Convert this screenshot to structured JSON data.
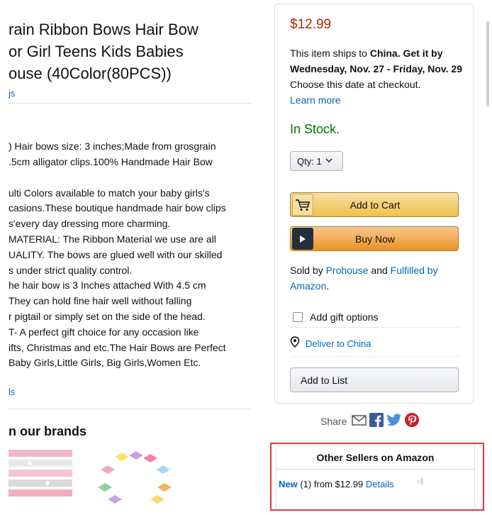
{
  "product": {
    "title_lines": [
      "rain Ribbon Bows Hair Bow",
      "or Girl Teens Kids Babies",
      "ouse (40Color(80PCS))"
    ],
    "cut_link": "js",
    "bullets": [
      ") Hair bows size: 3 inches;Made from grosgrain",
      ".5cm alligator clips.100% Handmade Hair Bow",
      "",
      "ulti Colors available to match your baby girls's",
      "casions.These boutique handmade hair bow clips",
      "s'every day dressing more charming.",
      "MATERIAL: The Ribbon Material we use are all",
      "UALITY. The bows are glued well with our skilled",
      "s under strict quality control.",
      "he hair bow is 3 Inches attached With 4.5 cm",
      " They can hold fine hair well without falling",
      "r pigtail or simply set on the side of the head.",
      "T- A perfect gift choice for any occasion like",
      "ifts, Christmas and etc.The Hair Bows are Perfect",
      "Baby Girls,Little Girls, Big Girls,Women Etc."
    ],
    "details_link": "ls",
    "brands_heading": "n our brands"
  },
  "buybox": {
    "price": "$12.99",
    "ships_pre": "This item ships to ",
    "ships_country": "China",
    "ships_mid": ". Get it by",
    "ships_dates": "Wednesday, Nov. 27 - Friday, Nov. 29",
    "ships_post": " Choose this date at checkout.",
    "learn_more": "Learn more",
    "stock": "In Stock.",
    "qty_label": "Qty:",
    "qty_value": "1",
    "add_to_cart": "Add to Cart",
    "buy_now": "Buy Now",
    "sold_by_pre": "Sold by ",
    "seller": "Prohouse",
    "and": " and ",
    "fulfilled_by": "Fulfilled by Amazon",
    "period": ".",
    "gift_label": "Add gift options",
    "deliver_label": "Deliver to China",
    "add_to_list": "Add to List"
  },
  "share": {
    "label": "Share"
  },
  "other_sellers": {
    "heading": "Other Sellers on Amazon",
    "new_label": "New",
    "count": "(1)",
    "from_price": "from $12.99",
    "details": "Details",
    "watermark": "›‖"
  },
  "colors": {
    "price": "#b12704",
    "stock": "#007600",
    "link": "#0066c0",
    "highlight": "#e0393e"
  },
  "icons": [
    "cart-icon",
    "play-icon",
    "location-pin-icon",
    "mail-icon",
    "facebook-icon",
    "twitter-icon",
    "pinterest-icon",
    "chevron-down-icon"
  ]
}
